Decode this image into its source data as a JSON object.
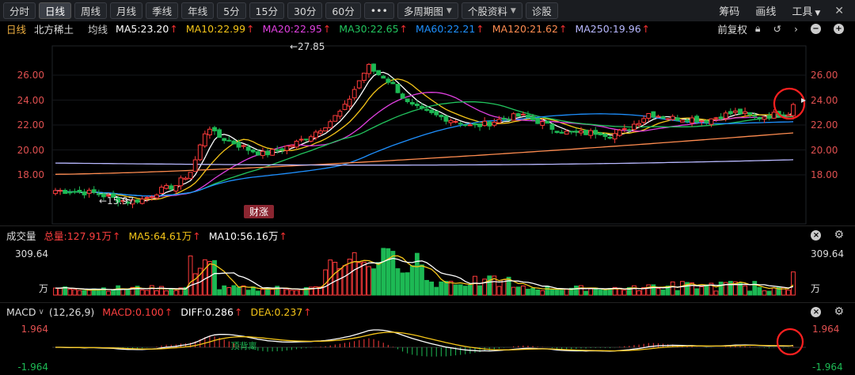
{
  "toolbar": {
    "buttons": [
      "分时",
      "日线",
      "周线",
      "月线",
      "季线",
      "年线",
      "5分",
      "15分",
      "30分",
      "60分",
      "•••"
    ],
    "active": "日线",
    "dropdowns": [
      "多周期图",
      "个股资料"
    ],
    "diag": "诊股",
    "right": [
      "筹码",
      "画线",
      "工具"
    ]
  },
  "stock": {
    "period": "日线",
    "name": "北方稀土",
    "ma_label": "均线",
    "ma5": "MA5:23.20",
    "ma10": "MA10:22.99",
    "ma20": "MA20:22.95",
    "ma30": "MA30:22.65",
    "ma60": "MA60:22.21",
    "ma120": "MA120:21.62",
    "ma250": "MA250:19.96",
    "adjust": "前复权",
    "high_label": "←27.85",
    "low_label": "←15.97",
    "event_tag": "财涨"
  },
  "price_axis": {
    "left": [
      "26.00",
      "24.00",
      "22.00",
      "20.00",
      "18.00"
    ],
    "right": [
      "26.00",
      "24.00",
      "22.00",
      "20.00",
      "18.00"
    ]
  },
  "volume": {
    "title": "成交量",
    "total": "总量:127.91万",
    "ma5": "MA5:64.61万",
    "ma10": "MA10:56.16万",
    "axis_top": "309.64",
    "axis_unit": "万"
  },
  "macd": {
    "title": "MACD",
    "params": "(12,26,9)",
    "macd": "MACD:0.100",
    "diff": "DIFF:0.286",
    "dea": "DEA:0.237",
    "axis_top": "1.964",
    "axis_bottom": "-1.964",
    "annotation": "顶背离"
  },
  "colors": {
    "ma5": "#ffffff",
    "ma10": "#f5c518",
    "ma20": "#e040e0",
    "ma30": "#22c55e",
    "ma60": "#1e90ff",
    "ma120": "#ff8c50",
    "ma250": "#b8b8ff",
    "up": "#ff3b3b",
    "down": "#1db954",
    "highlight": "#ff2020"
  }
}
